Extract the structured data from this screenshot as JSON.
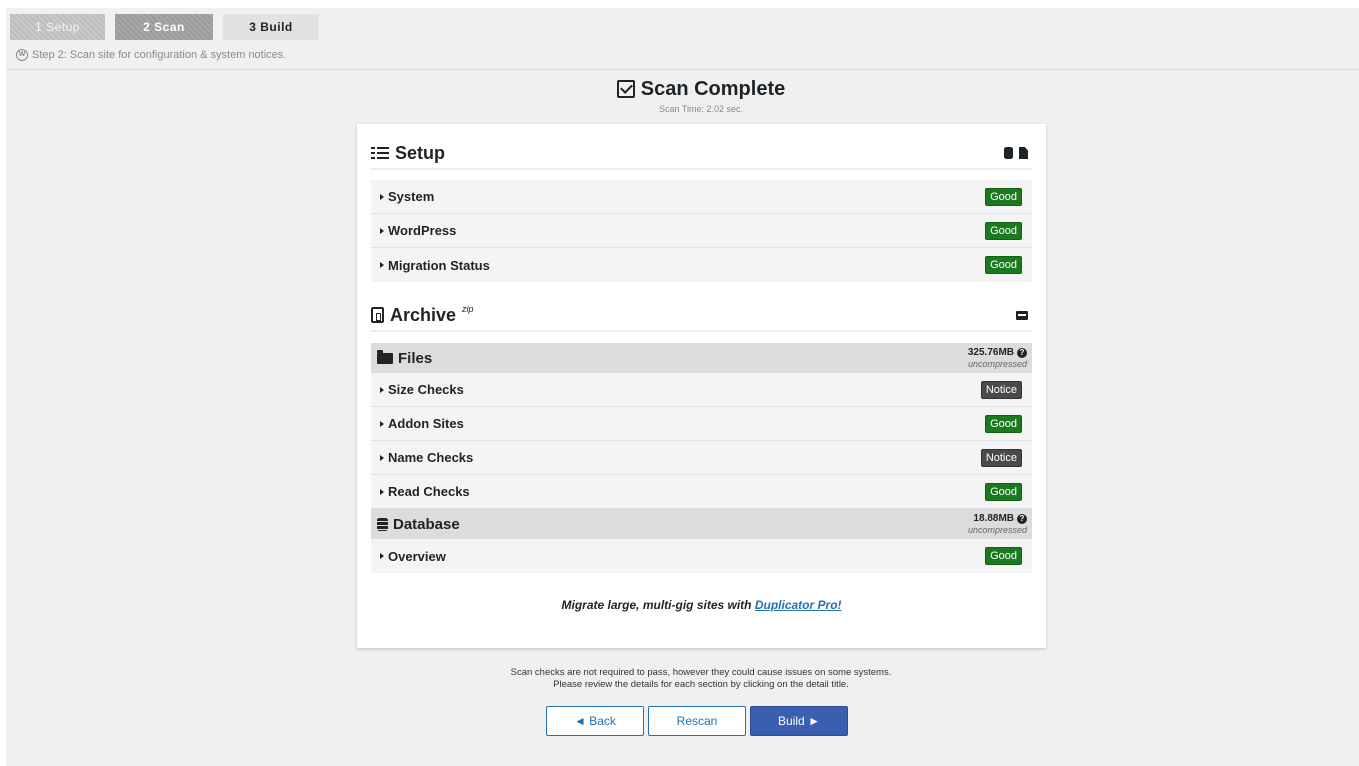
{
  "steps": [
    {
      "label": "1 Setup"
    },
    {
      "label": "2 Scan"
    },
    {
      "label": "3 Build"
    }
  ],
  "step_note": "Step 2: Scan site for configuration & system notices.",
  "heading": {
    "title": "Scan Complete",
    "scan_time": "Scan Time: 2.02 sec."
  },
  "setup": {
    "title": "Setup",
    "rows": [
      {
        "name": "System",
        "status": "Good"
      },
      {
        "name": "WordPress",
        "status": "Good"
      },
      {
        "name": "Migration Status",
        "status": "Good"
      }
    ]
  },
  "archive": {
    "title": "Archive",
    "format": "zip",
    "files": {
      "title": "Files",
      "size": "325.76MB",
      "size_note": "uncompressed",
      "rows": [
        {
          "name": "Size Checks",
          "status": "Notice"
        },
        {
          "name": "Addon Sites",
          "status": "Good"
        },
        {
          "name": "Name Checks",
          "status": "Notice"
        },
        {
          "name": "Read Checks",
          "status": "Good"
        }
      ]
    },
    "database": {
      "title": "Database",
      "size": "18.88MB",
      "size_note": "uncompressed",
      "rows": [
        {
          "name": "Overview",
          "status": "Good"
        }
      ]
    }
  },
  "promo": {
    "text": "Migrate large, multi-gig sites with ",
    "link": "Duplicator Pro!"
  },
  "help": {
    "line1": "Scan checks are not required to pass, however they could cause issues on some systems.",
    "line2": "Please review the details for each section by clicking on the detail title."
  },
  "buttons": {
    "back": "◄ Back",
    "rescan": "Rescan",
    "build": "Build ►"
  },
  "colors": {
    "good": "#1b7a1f",
    "notice": "#4a4a4a",
    "primary": "#3b5fb0",
    "link": "#2271b1"
  },
  "icons": [
    "wordpress-icon",
    "checkbox-icon",
    "checklist-icon",
    "database-icon",
    "file-icon",
    "zip-file-icon",
    "archive-box-icon",
    "folder-open-icon",
    "help-icon",
    "caret-right-icon"
  ]
}
